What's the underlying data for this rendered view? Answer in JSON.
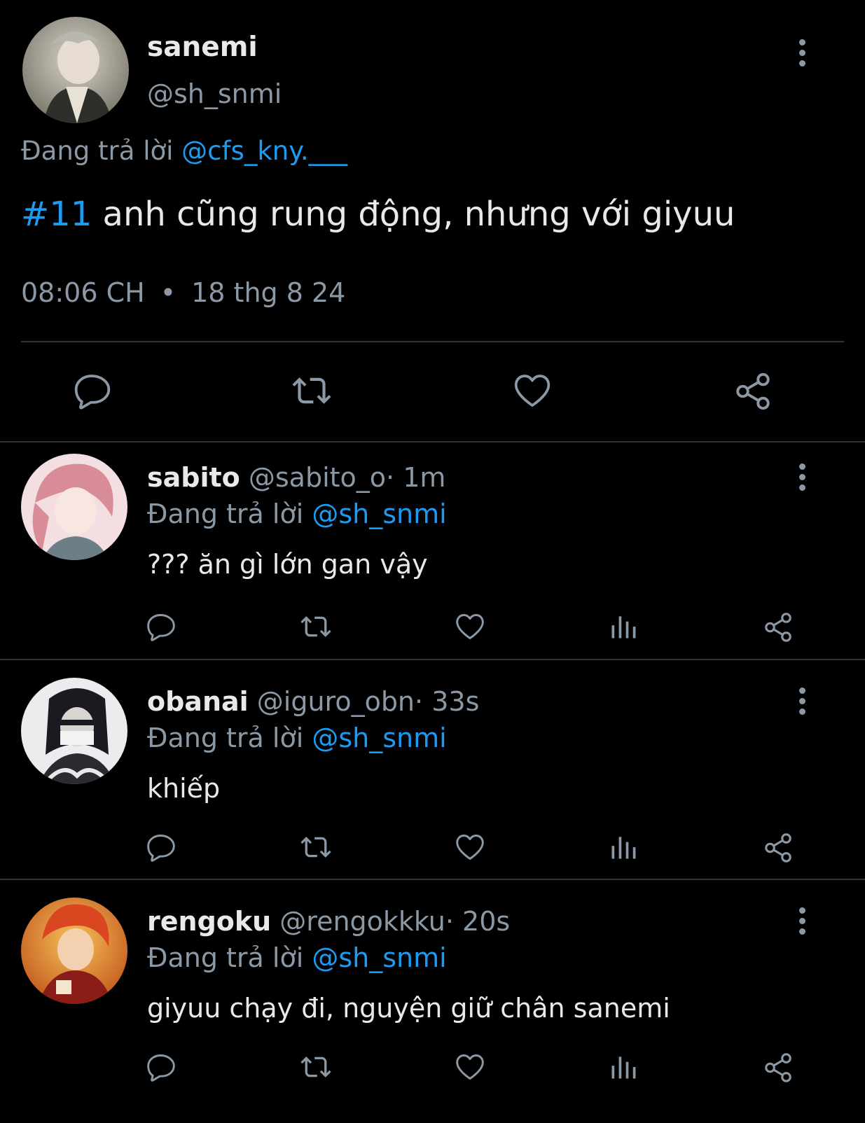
{
  "main_tweet": {
    "name": "sanemi",
    "handle": "@sh_snmi",
    "reply_prefix": "Đang trả lời",
    "reply_to": "@cfs_kny.___",
    "hashtag": "#11",
    "text": " anh cũng rung động, nhưng với giyuu",
    "time": "08:06 CH",
    "separator": "•",
    "date": "18 thg 8 24",
    "avatar_colors": [
      "#c9c3b8",
      "#6b6a62"
    ]
  },
  "replies": [
    {
      "name": "sabito",
      "handle": "@sabito_o",
      "dot": "·",
      "time": "1m",
      "reply_prefix": "Đang trả lời",
      "reply_to": "@sh_snmi",
      "text": "??? ăn gì lớn gan vậy",
      "avatar_colors": [
        "#f1d4d9",
        "#c46f7c"
      ]
    },
    {
      "name": "obanai",
      "handle": "@iguro_obn",
      "dot": "·",
      "time": "33s",
      "reply_prefix": "Đang trả lời",
      "reply_to": "@sh_snmi",
      "text": "khiếp",
      "avatar_colors": [
        "#e8e8ea",
        "#1c1c22"
      ]
    },
    {
      "name": "rengoku",
      "handle": "@rengokkku",
      "dot": "·",
      "time": "20s",
      "reply_prefix": "Đang trả lời",
      "reply_to": "@sh_snmi",
      "text": "giyuu chạy đi, nguyện giữ chân sanemi",
      "avatar_colors": [
        "#f0a13a",
        "#b5321e"
      ]
    }
  ],
  "colors": {
    "background": "#000000",
    "text": "#e7e9ea",
    "muted": "#8b98a5",
    "link": "#1d9bf0",
    "divider": "#2f3336"
  },
  "icons": [
    "reply-icon",
    "retweet-icon",
    "like-icon",
    "views-icon",
    "share-icon",
    "more-icon"
  ]
}
